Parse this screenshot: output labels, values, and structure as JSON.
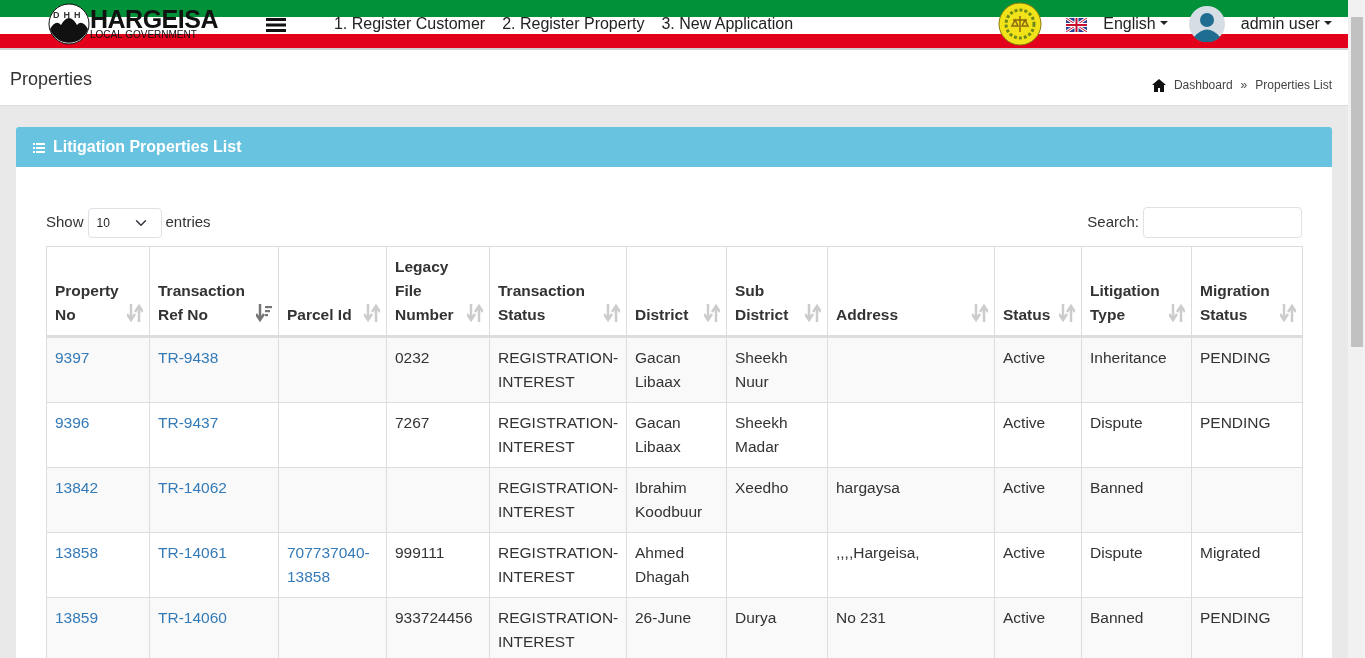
{
  "topbar": {
    "logo_title": "HARGEISA",
    "logo_subtitle": "LOCAL GOVERNMENT",
    "logo_letters": "DHH",
    "menu_links": [
      "1. Register Customer",
      "2. Register Property",
      "3. New Application"
    ],
    "language": "English",
    "user": "admin user"
  },
  "page_header": {
    "title": "Properties",
    "breadcrumb": [
      "Dashboard",
      "Properties List"
    ],
    "separator": "»"
  },
  "card": {
    "title": "Litigation Properties List",
    "length_menu": {
      "before": "Show",
      "value": "10",
      "after": "entries"
    },
    "search": {
      "label": "Search:"
    },
    "table": {
      "columns": [
        {
          "label": "Property No",
          "sorted": false
        },
        {
          "label": "Transaction Ref No",
          "sorted": true
        },
        {
          "label": "Parcel Id",
          "sorted": false
        },
        {
          "label": "Legacy File Number",
          "sorted": false
        },
        {
          "label": "Transaction Status",
          "sorted": false
        },
        {
          "label": "District",
          "sorted": false
        },
        {
          "label": "Sub District",
          "sorted": false
        },
        {
          "label": "Address",
          "sorted": false
        },
        {
          "label": "Status",
          "sorted": false
        },
        {
          "label": "Litigation Type",
          "sorted": false
        },
        {
          "label": "Migration Status",
          "sorted": false
        }
      ],
      "rows": [
        [
          "9397",
          "TR-9438",
          "",
          "0232",
          "REGISTRATION-INTEREST",
          "Gacan Libaax",
          "Sheekh Nuur",
          "",
          "Active",
          "Inheritance",
          "PENDING"
        ],
        [
          "9396",
          "TR-9437",
          "",
          "7267",
          "REGISTRATION-INTEREST",
          "Gacan Libaax",
          "Sheekh Madar",
          "",
          "Active",
          "Dispute",
          "PENDING"
        ],
        [
          "13842",
          "TR-14062",
          "",
          "",
          "REGISTRATION-INTEREST",
          "Ibrahim Koodbuur",
          "Xeedho",
          "hargaysa",
          "Active",
          "Banned",
          ""
        ],
        [
          "13858",
          "TR-14061",
          "707737040-13858",
          "999111",
          "REGISTRATION-INTEREST",
          "Ahmed Dhagah",
          "",
          ",,,,Hargeisa,",
          "Active",
          "Dispute",
          "Migrated"
        ],
        [
          "13859",
          "TR-14060",
          "",
          "933724456",
          "REGISTRATION-INTEREST",
          "26-June",
          "Durya",
          "No 231",
          "Active",
          "Banned",
          "PENDING"
        ]
      ]
    }
  }
}
